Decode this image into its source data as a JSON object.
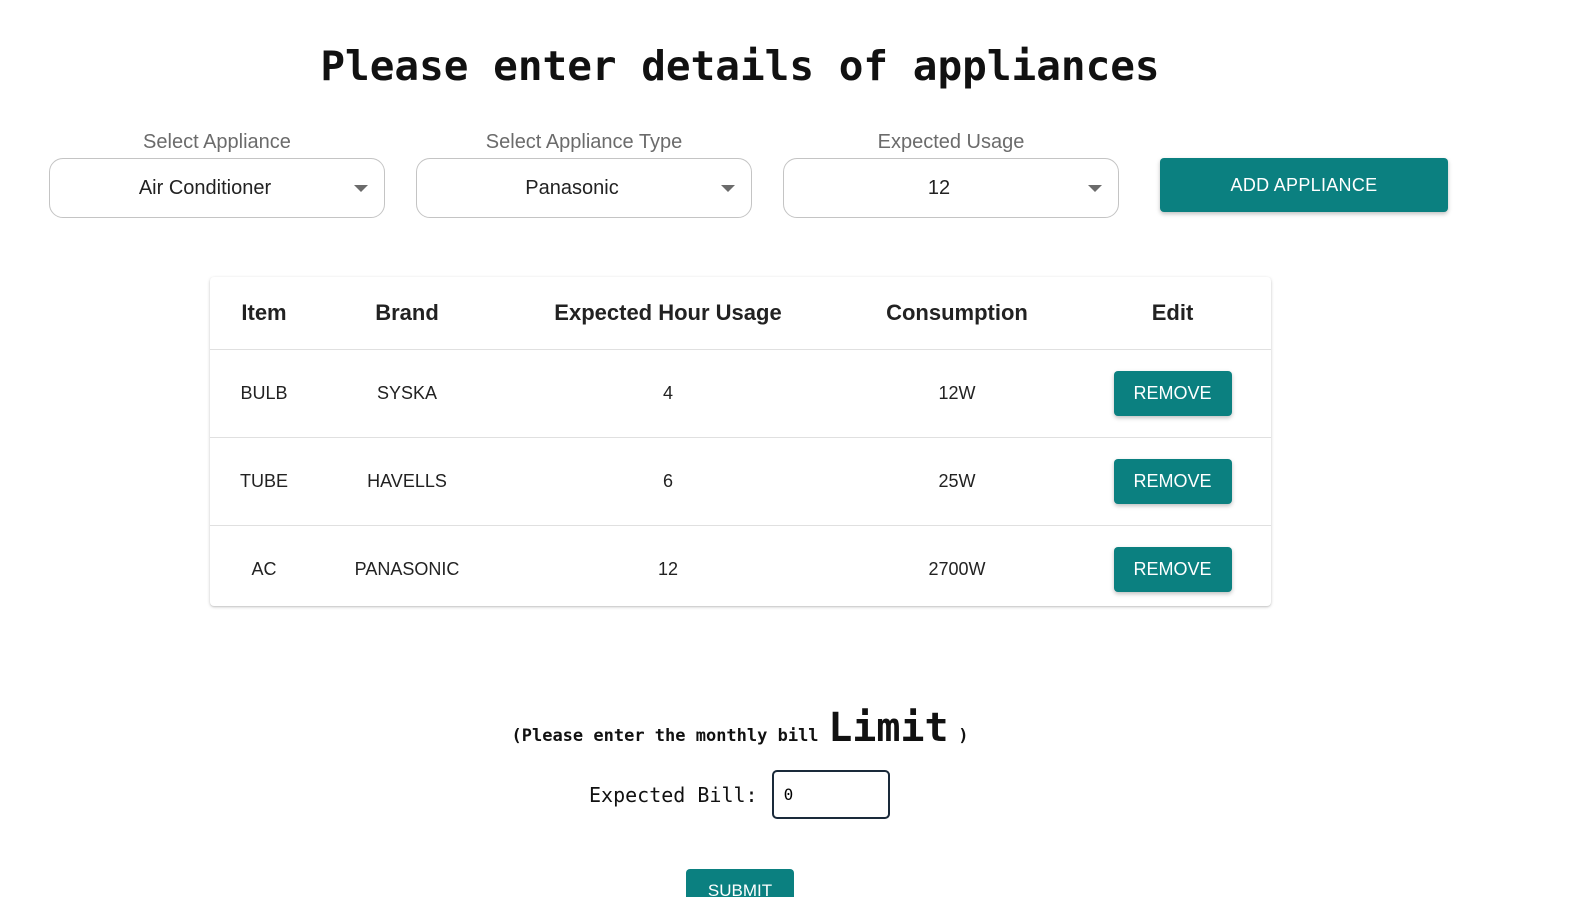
{
  "title": "Please enter details of appliances",
  "selects": {
    "appliance": {
      "label": "Select Appliance",
      "value": "Air Conditioner"
    },
    "type": {
      "label": "Select Appliance Type",
      "value": "Panasonic"
    },
    "usage": {
      "label": "Expected Usage",
      "value": "12"
    }
  },
  "add_button": "ADD APPLIANCE",
  "table": {
    "headers": [
      "Item",
      "Brand",
      "Expected Hour Usage",
      "Consumption",
      "Edit"
    ],
    "rows": [
      {
        "item": "BULB",
        "brand": "SYSKA",
        "hours": "4",
        "consumption": "12W",
        "action": "REMOVE"
      },
      {
        "item": "TUBE",
        "brand": "HAVELLS",
        "hours": "6",
        "consumption": "25W",
        "action": "REMOVE"
      },
      {
        "item": "AC",
        "brand": "PANASONIC",
        "hours": "12",
        "consumption": "2700W",
        "action": "REMOVE"
      }
    ]
  },
  "limit": {
    "prefix": "(Please enter the monthly bill",
    "emphasis": "Limit",
    "suffix": ")"
  },
  "bill": {
    "label": "Expected Bill:",
    "value": "0"
  },
  "submit_button": "SUBMIT",
  "colors": {
    "accent": "#0b8080"
  }
}
